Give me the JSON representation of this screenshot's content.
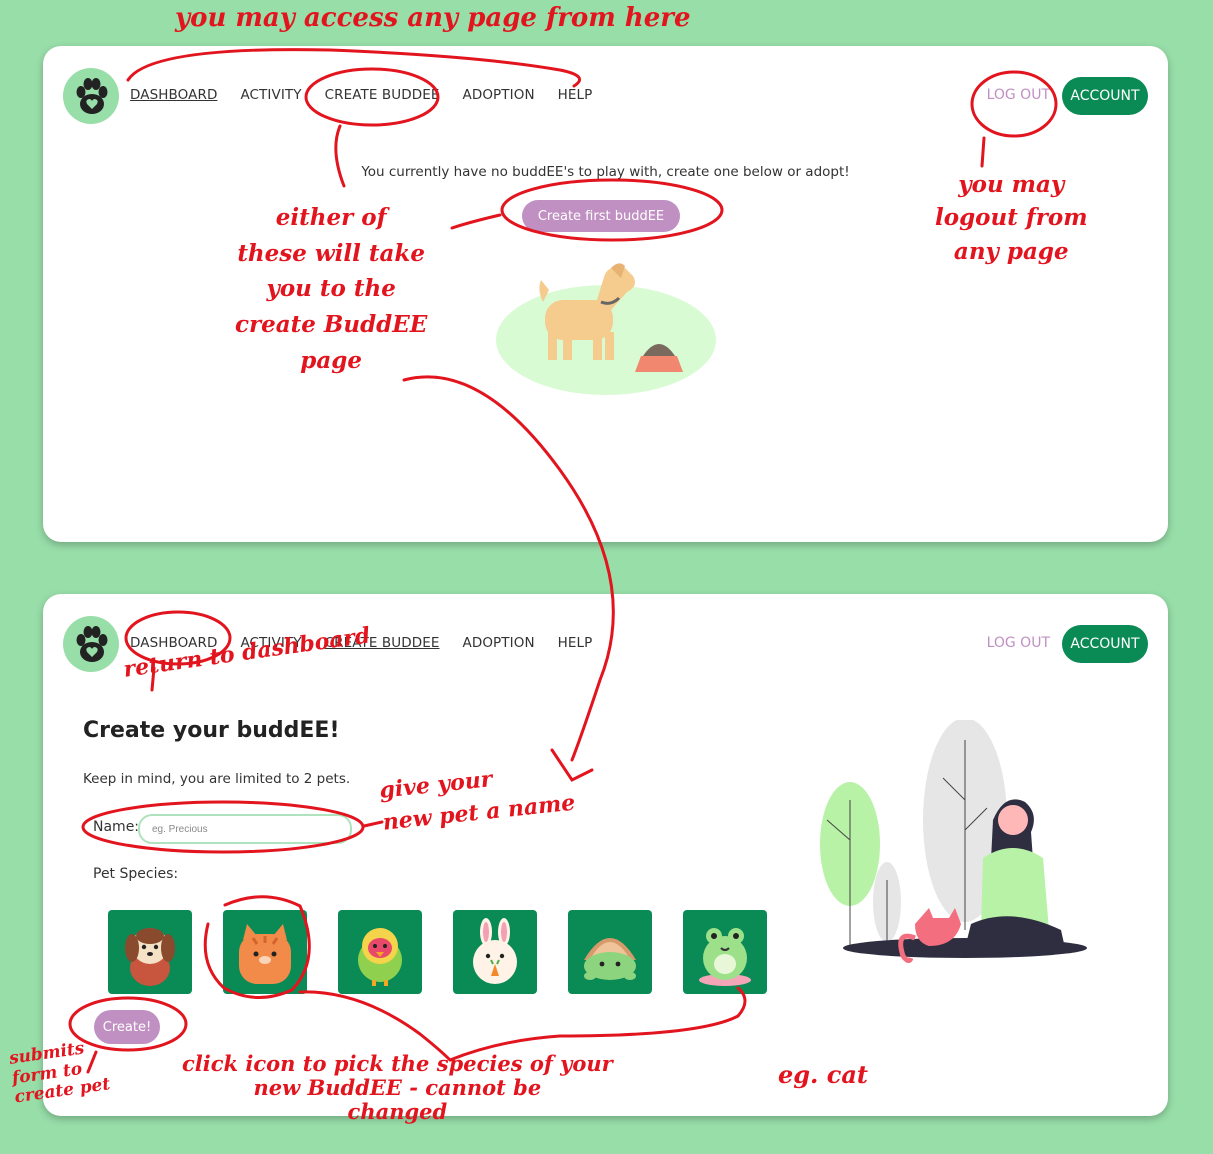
{
  "nav": {
    "links": [
      "DASHBOARD",
      "ACTIVITY",
      "CREATE BUDDEE",
      "ADOPTION",
      "HELP"
    ],
    "logout": "LOG OUT",
    "account": "ACCOUNT"
  },
  "dashboard": {
    "empty_message": "You currently have no buddEE's to play with, create one below or adopt!",
    "create_first_label": "Create first buddEE"
  },
  "create_page": {
    "title": "Create your buddEE!",
    "limit_text": "Keep in mind, you are limited to 2 pets.",
    "name_label": "Name:",
    "name_placeholder": "eg. Precious",
    "species_label": "Pet Species:",
    "species": [
      "dog",
      "cat",
      "bird",
      "bunny",
      "turtle",
      "frog"
    ],
    "create_label": "Create!"
  },
  "annotations": {
    "top": "you may access any page from here",
    "either": "either of\nthese will take\nyou to the\ncreate BuddEE\npage",
    "logout": "you may\nlogout from\nany page",
    "return": "return to dashboard",
    "name": "give your\nnew pet a name",
    "submit": "submits\nform to\ncreate pet",
    "species": "click icon to pick the species of your\nnew BuddEE - cannot be\nchanged",
    "eg": "eg. cat"
  },
  "colors": {
    "background": "#98dea9",
    "accent_green": "#0a8a55",
    "accent_purple": "#c190c3",
    "annotation_red": "#e2141e"
  }
}
